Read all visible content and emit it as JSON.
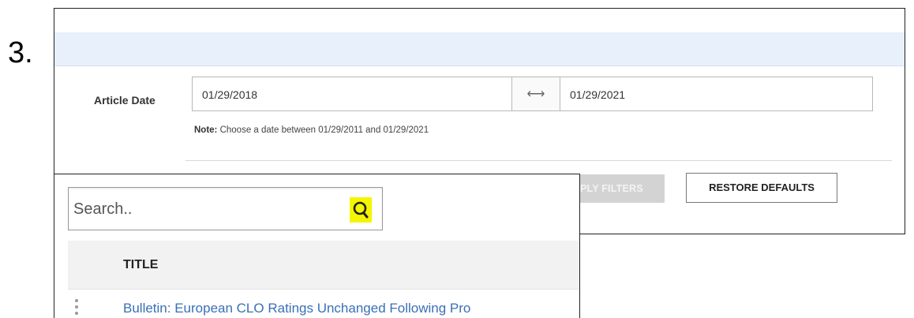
{
  "step_number": "3.",
  "filters": {
    "article_date_label": "Article Date",
    "start_date": "01/29/2018",
    "range_separator": "⟷",
    "end_date": "01/29/2021",
    "note_label": "Note:",
    "note_text": " Choose a date between 01/29/2011 and 01/29/2021",
    "apply_label": "APPLY FILTERS",
    "restore_label": "RESTORE DEFAULTS"
  },
  "search": {
    "placeholder": "Search..",
    "icon": "search-icon",
    "icon_highlight_color": "#f5f500"
  },
  "table": {
    "columns": [
      "TITLE"
    ],
    "rows": [
      {
        "title": "Bulletin: European CLO Ratings Unchanged Following Pro"
      }
    ]
  },
  "colors": {
    "top_band": "#e7f0fb",
    "link": "#3a6fb7",
    "disabled_button": "#d3d3d3"
  }
}
